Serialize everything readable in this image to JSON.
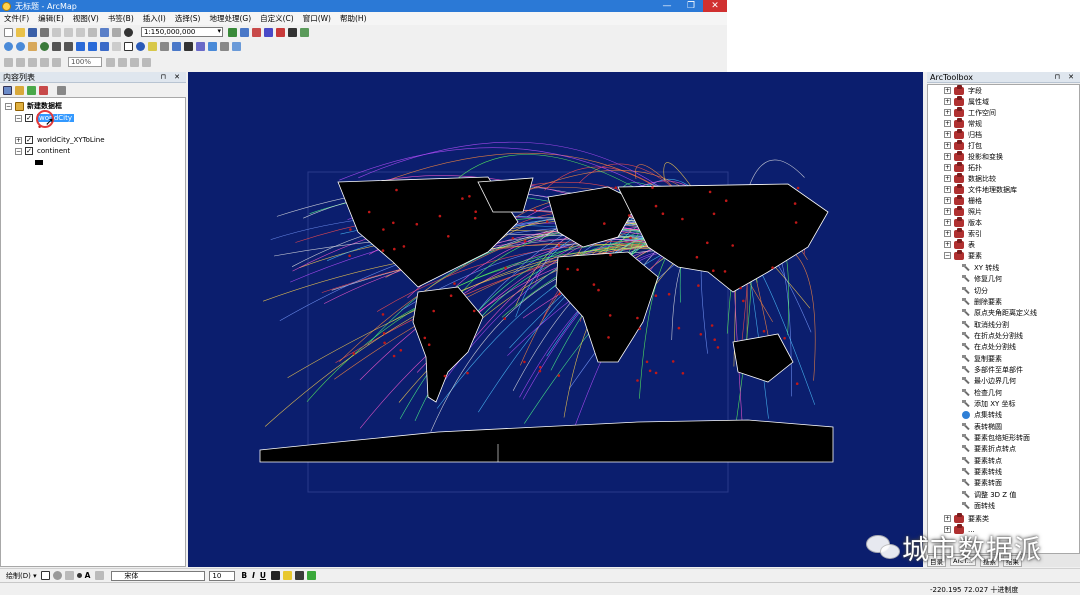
{
  "window": {
    "title": "无标题 - ArcMap",
    "minimize": "—",
    "maximize": "❐",
    "close": "✕"
  },
  "menu": [
    "文件(F)",
    "编辑(E)",
    "视图(V)",
    "书签(B)",
    "插入(I)",
    "选择(S)",
    "地理处理(G)",
    "自定义(C)",
    "窗口(W)",
    "帮助(H)"
  ],
  "toolbar": {
    "scale": "1:150,000,000",
    "zoom": "100%"
  },
  "toc": {
    "header": "内容列表",
    "header_buttons": "⊓ ✕",
    "frame": "新建数据框",
    "layers": [
      {
        "label": "worldCity",
        "checked": "✓",
        "expand": "−"
      },
      {
        "label": "worldCity_XYToLine",
        "checked": "✓",
        "expand": "+"
      },
      {
        "label": "continent",
        "checked": "✓",
        "expand": "−"
      }
    ]
  },
  "toolbox": {
    "header": "ArcToolbox",
    "header_buttons": "⊓ ✕",
    "toolsets": [
      "字段",
      "属性域",
      "工作空间",
      "常规",
      "归档",
      "打包",
      "投影和变换",
      "拓扑",
      "数据比较",
      "文件地理数据库",
      "栅格",
      "照片",
      "版本",
      "索引",
      "表"
    ],
    "open_toolset": "要素",
    "tools": [
      "XY 转线",
      "修复几何",
      "切分",
      "删除要素",
      "原点夹角距离定义线",
      "取消线分割",
      "在折点处分割线",
      "在点处分割线",
      "复制要素",
      "多部件至单部件",
      "最小边界几何",
      "检查几何",
      "添加 XY 坐标",
      "点集转线",
      "表转椭圆",
      "要素包络矩形转面",
      "要素折点转点",
      "要素转点",
      "要素转线",
      "要素转面",
      "调整 3D Z 值",
      "面转线"
    ],
    "script_tool": "点集转线",
    "after": [
      "要素类",
      "..."
    ],
    "tabs": [
      "目录",
      "ArcT...",
      "搜索",
      "结果"
    ]
  },
  "drawbar": {
    "label": "绘制(D) ▾",
    "font": "宋体",
    "size": "10",
    "bold": "B",
    "italic": "I",
    "underline": "U",
    "text_tool": "A"
  },
  "status": {
    "coords": "-220.195  72.027 十进制度"
  },
  "watermark": {
    "text": "城市数据派"
  }
}
